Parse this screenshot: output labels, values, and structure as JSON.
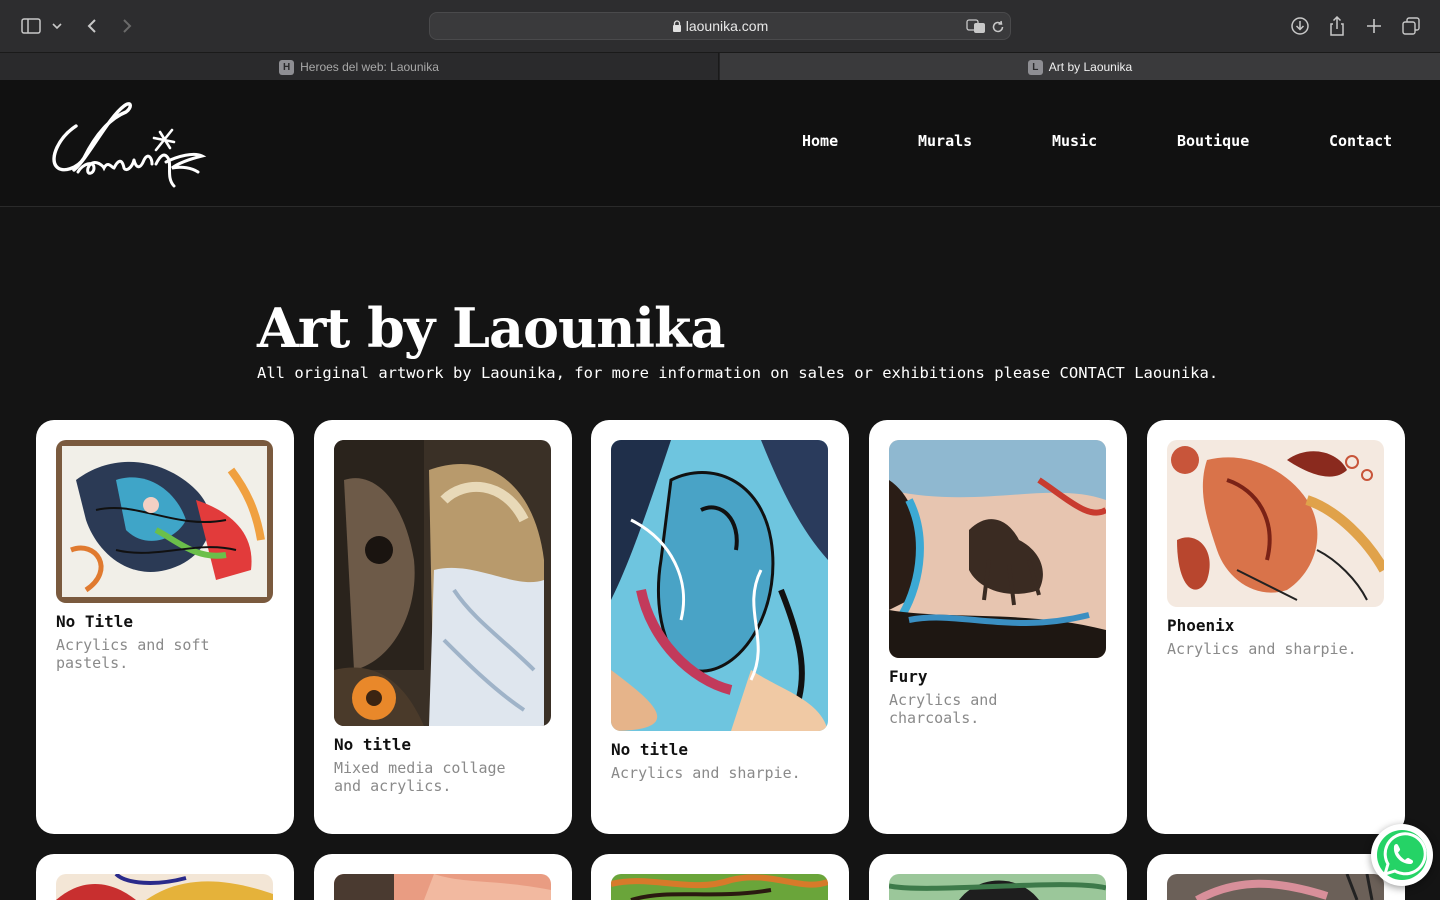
{
  "browser": {
    "url": "laounika.com",
    "tabs": [
      {
        "label": "Heroes del web: Laounika",
        "favicon": "H"
      },
      {
        "label": "Art by Laounika",
        "favicon": "L"
      }
    ]
  },
  "site": {
    "logo_text": "Laounika",
    "nav": [
      "Home",
      "Murals",
      "Music",
      "Boutique",
      "Contact"
    ]
  },
  "hero": {
    "title": "Art by Laounika",
    "subtitle": "All original artwork by Laounika, for more information on sales or exhibitions please CONTACT Laounika."
  },
  "artworks": [
    {
      "title": "No Title",
      "desc": "Acrylics and soft pastels."
    },
    {
      "title": "No title",
      "desc": "Mixed media collage and acrylics."
    },
    {
      "title": "No title",
      "desc": "Acrylics and sharpie."
    },
    {
      "title": "Fury",
      "desc": "Acrylics and charcoals."
    },
    {
      "title": "Phoenix",
      "desc": "Acrylics and sharpie."
    }
  ],
  "colors": {
    "page_bg": "#141414",
    "header_bg": "#111111",
    "card_bg": "#ffffff",
    "whatsapp": "#25d366"
  }
}
